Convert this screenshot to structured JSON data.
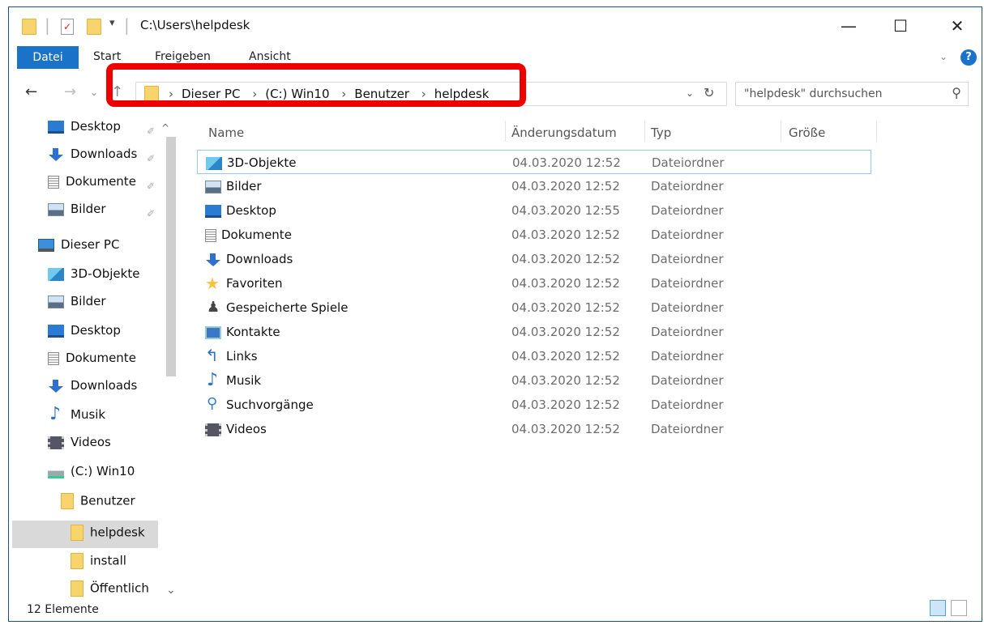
{
  "window": {
    "title": "C:\\Users\\helpdesk",
    "minimize": "—",
    "maximize": "☐",
    "close": "✕"
  },
  "ribbon": {
    "tabs": [
      "Datei",
      "Start",
      "Freigeben",
      "Ansicht"
    ]
  },
  "address": {
    "crumbs": [
      "Dieser PC",
      "(C:) Win10",
      "Benutzer",
      "helpdesk"
    ],
    "search_placeholder": "\"helpdesk\" durchsuchen",
    "separator": "›"
  },
  "sidebar": {
    "quick": [
      {
        "label": "Desktop",
        "icon": "desktop-icon"
      },
      {
        "label": "Downloads",
        "icon": "download-icon"
      },
      {
        "label": "Dokumente",
        "icon": "document-icon"
      },
      {
        "label": "Bilder",
        "icon": "pictures-icon"
      }
    ],
    "pc_label": "Dieser PC",
    "pc_items": [
      {
        "label": "3D-Objekte",
        "icon": "3d-objects-icon"
      },
      {
        "label": "Bilder",
        "icon": "pictures-icon"
      },
      {
        "label": "Desktop",
        "icon": "desktop-icon"
      },
      {
        "label": "Dokumente",
        "icon": "document-icon"
      },
      {
        "label": "Downloads",
        "icon": "download-icon"
      },
      {
        "label": "Musik",
        "icon": "music-icon"
      },
      {
        "label": "Videos",
        "icon": "video-icon"
      },
      {
        "label": "(C:) Win10",
        "icon": "drive-icon"
      },
      {
        "label": "Benutzer",
        "icon": "folder-icon"
      },
      {
        "label": "helpdesk",
        "icon": "folder-icon",
        "selected": true
      },
      {
        "label": "install",
        "icon": "folder-icon"
      },
      {
        "label": "Öffentlich",
        "icon": "folder-icon"
      }
    ]
  },
  "columns": {
    "name": "Name",
    "date": "Änderungsdatum",
    "type": "Typ",
    "size": "Größe"
  },
  "files": [
    {
      "name": "3D-Objekte",
      "date": "04.03.2020 12:52",
      "type": "Dateiordner",
      "icon": "3d-objects-icon"
    },
    {
      "name": "Bilder",
      "date": "04.03.2020 12:52",
      "type": "Dateiordner",
      "icon": "pictures-icon"
    },
    {
      "name": "Desktop",
      "date": "04.03.2020 12:55",
      "type": "Dateiordner",
      "icon": "desktop-icon"
    },
    {
      "name": "Dokumente",
      "date": "04.03.2020 12:52",
      "type": "Dateiordner",
      "icon": "document-icon"
    },
    {
      "name": "Downloads",
      "date": "04.03.2020 12:52",
      "type": "Dateiordner",
      "icon": "download-icon"
    },
    {
      "name": "Favoriten",
      "date": "04.03.2020 12:52",
      "type": "Dateiordner",
      "icon": "favorites-star-icon"
    },
    {
      "name": "Gespeicherte Spiele",
      "date": "04.03.2020 12:52",
      "type": "Dateiordner",
      "icon": "saved-games-icon"
    },
    {
      "name": "Kontakte",
      "date": "04.03.2020 12:52",
      "type": "Dateiordner",
      "icon": "contacts-icon"
    },
    {
      "name": "Links",
      "date": "04.03.2020 12:52",
      "type": "Dateiordner",
      "icon": "links-icon"
    },
    {
      "name": "Musik",
      "date": "04.03.2020 12:52",
      "type": "Dateiordner",
      "icon": "music-icon"
    },
    {
      "name": "Suchvorgänge",
      "date": "04.03.2020 12:52",
      "type": "Dateiordner",
      "icon": "searches-icon"
    },
    {
      "name": "Videos",
      "date": "04.03.2020 12:52",
      "type": "Dateiordner",
      "icon": "video-icon"
    }
  ],
  "status": {
    "count": "12 Elemente"
  },
  "colors": {
    "highlight": "#ee0000",
    "file_tab": "#1a73c8",
    "selection": "#99c9ef"
  }
}
